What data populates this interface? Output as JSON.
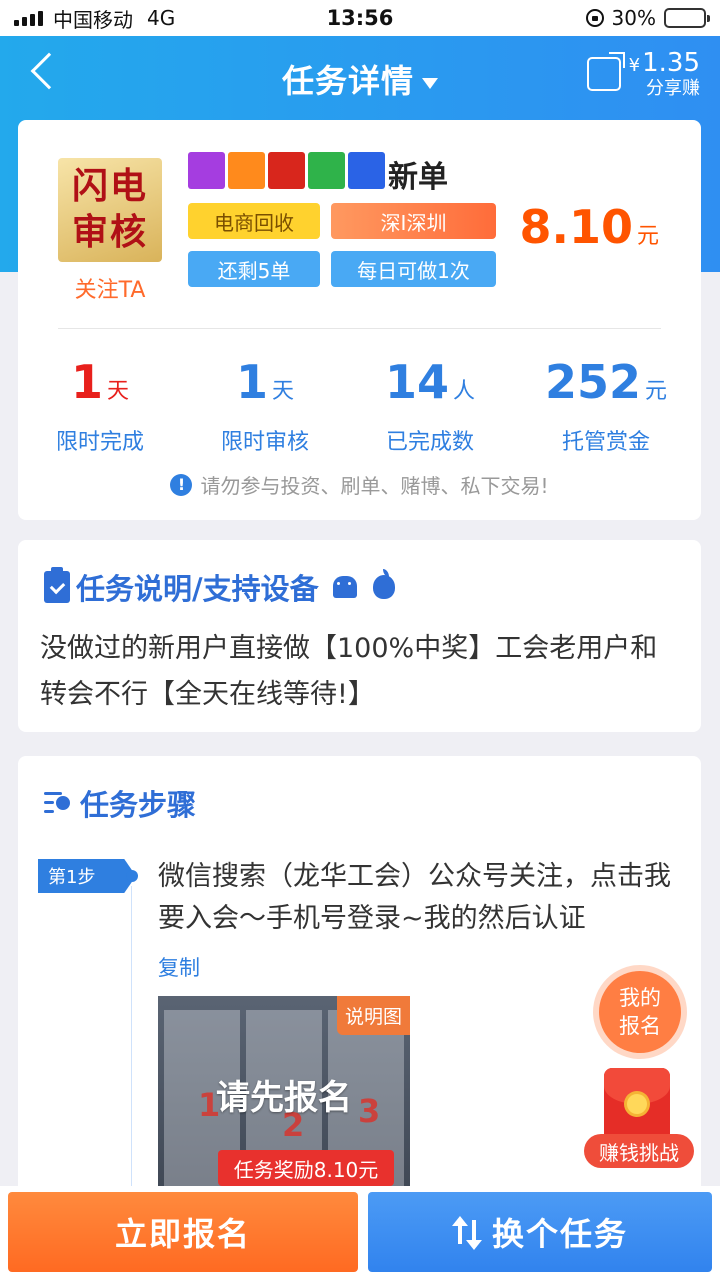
{
  "status_bar": {
    "carrier": "中国移动",
    "network": "4G",
    "time": "13:56",
    "battery": "30%",
    "battery_level": 0.3
  },
  "nav": {
    "title": "任务详情",
    "share_amount": "1.35",
    "share_currency": "¥",
    "share_label": "分享赚"
  },
  "task": {
    "publisher_logo_lines": [
      "闪电",
      "审核"
    ],
    "follow_label": "关注TA",
    "swatch_colors": [
      "#a53de0",
      "#ff8a1c",
      "#d8261c",
      "#2fb34a",
      "#2a63e6"
    ],
    "title_suffix": "新单",
    "tags": [
      "电商回收",
      "深I深圳",
      "还剩5单",
      "每日可做1次"
    ],
    "price": "8.10",
    "price_unit": "元",
    "stats": [
      {
        "value": "1",
        "unit": "天",
        "label": "限时完成"
      },
      {
        "value": "1",
        "unit": "天",
        "label": "限时审核"
      },
      {
        "value": "14",
        "unit": "人",
        "label": "已完成数"
      },
      {
        "value": "252",
        "unit": "元",
        "label": "托管赏金"
      }
    ],
    "warning": "请勿参与投资、刷单、赌博、私下交易!"
  },
  "description": {
    "title": "任务说明/支持设备",
    "text": "没做过的新用户直接做【100%中奖】工会老用户和转会不行【全天在线等待!】"
  },
  "steps": {
    "title": "任务步骤",
    "items": [
      {
        "badge": "第1步",
        "text": "微信搜索（龙华工会）公众号关注，点击我要入会～手机号登录~我的然后认证",
        "copy_label": "复制",
        "image_badge": "说明图",
        "image_overlay": "请先报名"
      }
    ]
  },
  "floating": {
    "mine_label": "我的报名",
    "challenge_label": "赚钱挑战"
  },
  "reward_tip": "任务奖励8.10元",
  "bottom": {
    "signup_label": "立即报名",
    "switch_label": "换个任务"
  },
  "colors": {
    "accent": "#2f7fe0",
    "price": "#ff5400",
    "nav_bg": "#23a9ec",
    "stat_red": "#e8201c"
  }
}
